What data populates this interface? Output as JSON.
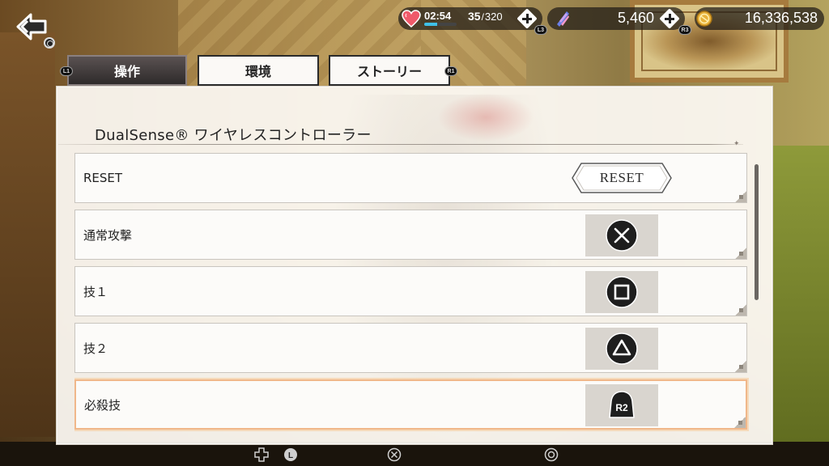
{
  "topbar": {
    "stamina": {
      "timer": "02:54",
      "current": "35",
      "separator": "/",
      "max": "320",
      "fill": 0.4
    },
    "gems": {
      "amount": "5,460"
    },
    "gold": {
      "amount": "16,336,538"
    },
    "badges": {
      "l3": "L3",
      "r3": "R3",
      "l1": "L1",
      "r1": "R1"
    }
  },
  "tabs": [
    {
      "label": "操作",
      "active": true
    },
    {
      "label": "環境",
      "active": false
    },
    {
      "label": "ストーリー",
      "active": false
    }
  ],
  "panel": {
    "title": "DualSense® ワイヤレスコントローラー",
    "rows": [
      {
        "label": "RESET",
        "control": "reset-button",
        "button_label": "RESET"
      },
      {
        "label": "通常攻撃",
        "control": "cross-button-icon"
      },
      {
        "label": "技１",
        "control": "square-button-icon"
      },
      {
        "label": "技２",
        "control": "triangle-button-icon"
      },
      {
        "label": "必殺技",
        "control": "r2-button-icon",
        "button_label": "R2",
        "selected": true
      }
    ]
  },
  "hints": [
    "dpad-icon",
    "l-stick-icon",
    "cross-button-icon",
    "circle-button-icon"
  ],
  "colors": {
    "selected_border": "#f0b78a",
    "active_tab": "#3a3434",
    "stamina_bar": "#3fc0e8",
    "panel_bg": "#fdfaf4"
  }
}
